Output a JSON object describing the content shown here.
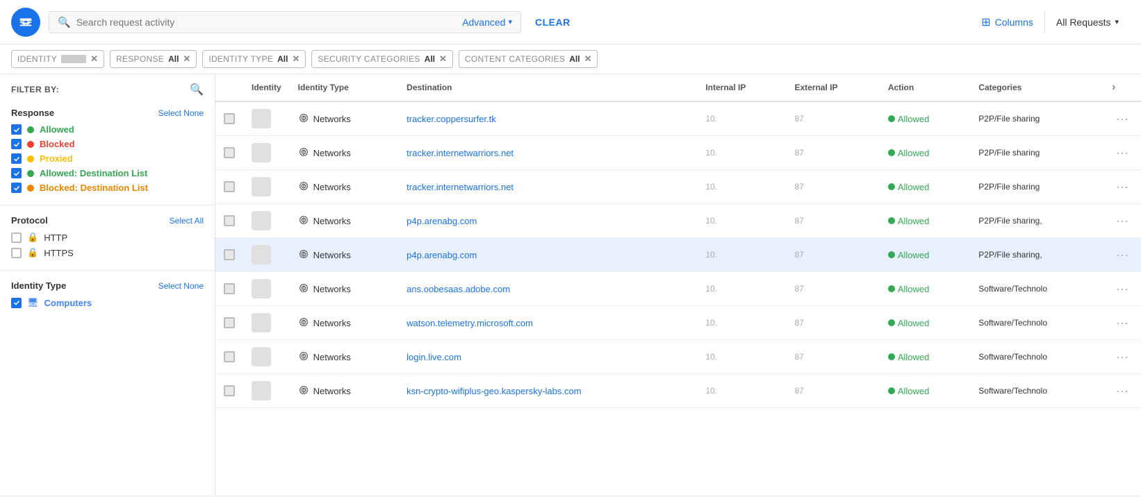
{
  "topbar": {
    "search_placeholder": "Search request activity",
    "advanced_label": "Advanced",
    "clear_label": "CLEAR",
    "columns_label": "Columns",
    "all_requests_label": "All Requests"
  },
  "chips": [
    {
      "id": "identity",
      "label": "IDENTITY",
      "value": ""
    },
    {
      "id": "response",
      "label": "RESPONSE",
      "value": "All"
    },
    {
      "id": "identity_type",
      "label": "IDENTITY TYPE",
      "value": "All"
    },
    {
      "id": "security_categories",
      "label": "SECURITY CATEGORIES",
      "value": "All"
    },
    {
      "id": "content_categories",
      "label": "CONTENT CATEGORIES",
      "value": "All"
    }
  ],
  "sidebar": {
    "filter_by": "FILTER BY:",
    "response": {
      "title": "Response",
      "action": "Select None",
      "items": [
        {
          "label": "Allowed",
          "color": "green",
          "checked": true
        },
        {
          "label": "Blocked",
          "color": "orange-red",
          "checked": true
        },
        {
          "label": "Proxied",
          "color": "yellow",
          "checked": true
        },
        {
          "label": "Allowed: Destination List",
          "color": "green",
          "checked": true
        },
        {
          "label": "Blocked: Destination List",
          "color": "orange",
          "checked": true
        }
      ]
    },
    "protocol": {
      "title": "Protocol",
      "action": "Select All",
      "items": [
        {
          "label": "HTTP",
          "type": "http",
          "checked": false
        },
        {
          "label": "HTTPS",
          "type": "https",
          "checked": false
        }
      ]
    },
    "identity_type": {
      "title": "Identity Type",
      "action": "Select None",
      "items": [
        {
          "label": "Computers",
          "color": "blue",
          "checked": true
        }
      ]
    }
  },
  "table": {
    "columns": [
      {
        "id": "checkbox",
        "label": ""
      },
      {
        "id": "identity",
        "label": "Identity"
      },
      {
        "id": "identity_type",
        "label": "Identity Type"
      },
      {
        "id": "destination",
        "label": "Destination"
      },
      {
        "id": "internal_ip",
        "label": "Internal IP"
      },
      {
        "id": "external_ip",
        "label": "External IP"
      },
      {
        "id": "action",
        "label": "Action"
      },
      {
        "id": "categories",
        "label": "Categories"
      },
      {
        "id": "more",
        "label": ""
      }
    ],
    "rows": [
      {
        "identity": "",
        "identity_type": "Networks",
        "destination": "tracker.coppersurfer.tk",
        "internal_ip": "10.",
        "external_ip": "87",
        "action": "Allowed",
        "categories": "P2P/File sharing",
        "highlighted": false
      },
      {
        "identity": "",
        "identity_type": "Networks",
        "destination": "tracker.internetwarriors.net",
        "internal_ip": "10.",
        "external_ip": "87",
        "action": "Allowed",
        "categories": "P2P/File sharing",
        "highlighted": false
      },
      {
        "identity": "",
        "identity_type": "Networks",
        "destination": "tracker.internetwarriors.net",
        "internal_ip": "10.",
        "external_ip": "87",
        "action": "Allowed",
        "categories": "P2P/File sharing",
        "highlighted": false
      },
      {
        "identity": "",
        "identity_type": "Networks",
        "destination": "p4p.arenabg.com",
        "internal_ip": "10.",
        "external_ip": "87",
        "action": "Allowed",
        "categories": "P2P/File sharing,",
        "highlighted": false
      },
      {
        "identity": "",
        "identity_type": "Networks",
        "destination": "p4p.arenabg.com",
        "internal_ip": "10.",
        "external_ip": "87",
        "action": "Allowed",
        "categories": "P2P/File sharing,",
        "highlighted": true
      },
      {
        "identity": "",
        "identity_type": "Networks",
        "destination": "ans.oobesaas.adobe.com",
        "internal_ip": "10.",
        "external_ip": "87",
        "action": "Allowed",
        "categories": "Software/Technolo",
        "highlighted": false
      },
      {
        "identity": "",
        "identity_type": "Networks",
        "destination": "watson.telemetry.microsoft.com",
        "internal_ip": "10.",
        "external_ip": "87",
        "action": "Allowed",
        "categories": "Software/Technolo",
        "highlighted": false
      },
      {
        "identity": "",
        "identity_type": "Networks",
        "destination": "login.live.com",
        "internal_ip": "10.",
        "external_ip": "87",
        "action": "Allowed",
        "categories": "Software/Technolo",
        "highlighted": false
      },
      {
        "identity": "",
        "identity_type": "Networks",
        "destination": "ksn-crypto-wifiplus-geo.kaspersky-labs.com",
        "internal_ip": "10.",
        "external_ip": "87",
        "action": "Allowed",
        "categories": "Software/Technolo",
        "highlighted": false
      }
    ]
  },
  "icons": {
    "search": "🔍",
    "logo": "▼",
    "columns_grid": "⊞",
    "close": "✕",
    "chevron_right": "›",
    "more": "…",
    "networks": "⛙"
  }
}
